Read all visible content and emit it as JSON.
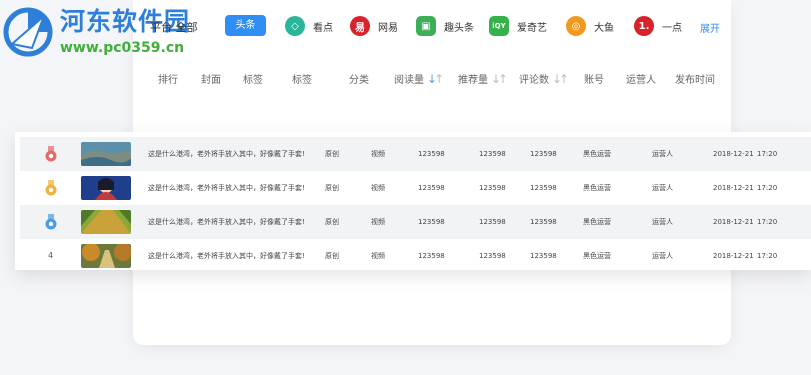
{
  "watermark": {
    "title": "河东软件园",
    "url": "www.pc0359.cn"
  },
  "filter": {
    "all_label": "平台 全部",
    "selected_chip": "头条",
    "platforms": [
      {
        "label": "看点",
        "icon": "kandian-icon",
        "color": "#2bb59a"
      },
      {
        "label": "网易",
        "icon": "netease-icon",
        "color": "#d8232a"
      },
      {
        "label": "趣头条",
        "icon": "qutoutiao-icon",
        "color": "#3fae5a"
      },
      {
        "label": "爱奇艺",
        "icon": "iqiyi-icon",
        "color": "#35b34a"
      },
      {
        "label": "大鱼",
        "icon": "dayu-icon",
        "color": "#f29a1f"
      },
      {
        "label": "一点",
        "icon": "yidian-icon",
        "color": "#d8232a"
      }
    ],
    "expand_label": "展开"
  },
  "headers": {
    "rank": "排行",
    "cover": "封面",
    "tag1": "标签",
    "tag2": "标签",
    "category": "分类",
    "reads": "阅读量",
    "recommend": "推荐量",
    "comments": "评论数",
    "account": "账号",
    "operator": "运营人",
    "publish_time": "发布时间"
  },
  "rows": [
    {
      "rank": "1",
      "medal": "#e36a6a",
      "title": "这是什么港湾，老外将手放入其中，好像戴了手套!",
      "source": "原创",
      "category": "视频",
      "reads": "123598",
      "recommend": "123598",
      "comments": "123598",
      "account": "黑色运营",
      "operator": "运营人",
      "date": "2018-12-21",
      "time": "17:20"
    },
    {
      "rank": "2",
      "medal": "#f0b23c",
      "title": "这是什么港湾，老外将手放入其中，好像戴了手套!",
      "source": "原创",
      "category": "视频",
      "reads": "123598",
      "recommend": "123598",
      "comments": "123598",
      "account": "黑色运营",
      "operator": "运营人",
      "date": "2018-12-21",
      "time": "17:20"
    },
    {
      "rank": "3",
      "medal": "#4a9be8",
      "title": "这是什么港湾，老外将手放入其中，好像戴了手套!",
      "source": "原创",
      "category": "视频",
      "reads": "123598",
      "recommend": "123598",
      "comments": "123598",
      "account": "黑色运营",
      "operator": "运营人",
      "date": "2018-12-21",
      "time": "17:20"
    },
    {
      "rank": "4",
      "medal": "",
      "title": "这是什么港湾，老外将手放入其中，好像戴了手套!",
      "source": "原创",
      "category": "视频",
      "reads": "123598",
      "recommend": "123598",
      "comments": "123598",
      "account": "黑色运营",
      "operator": "运营人",
      "date": "2018-12-21",
      "time": "17:20"
    }
  ]
}
